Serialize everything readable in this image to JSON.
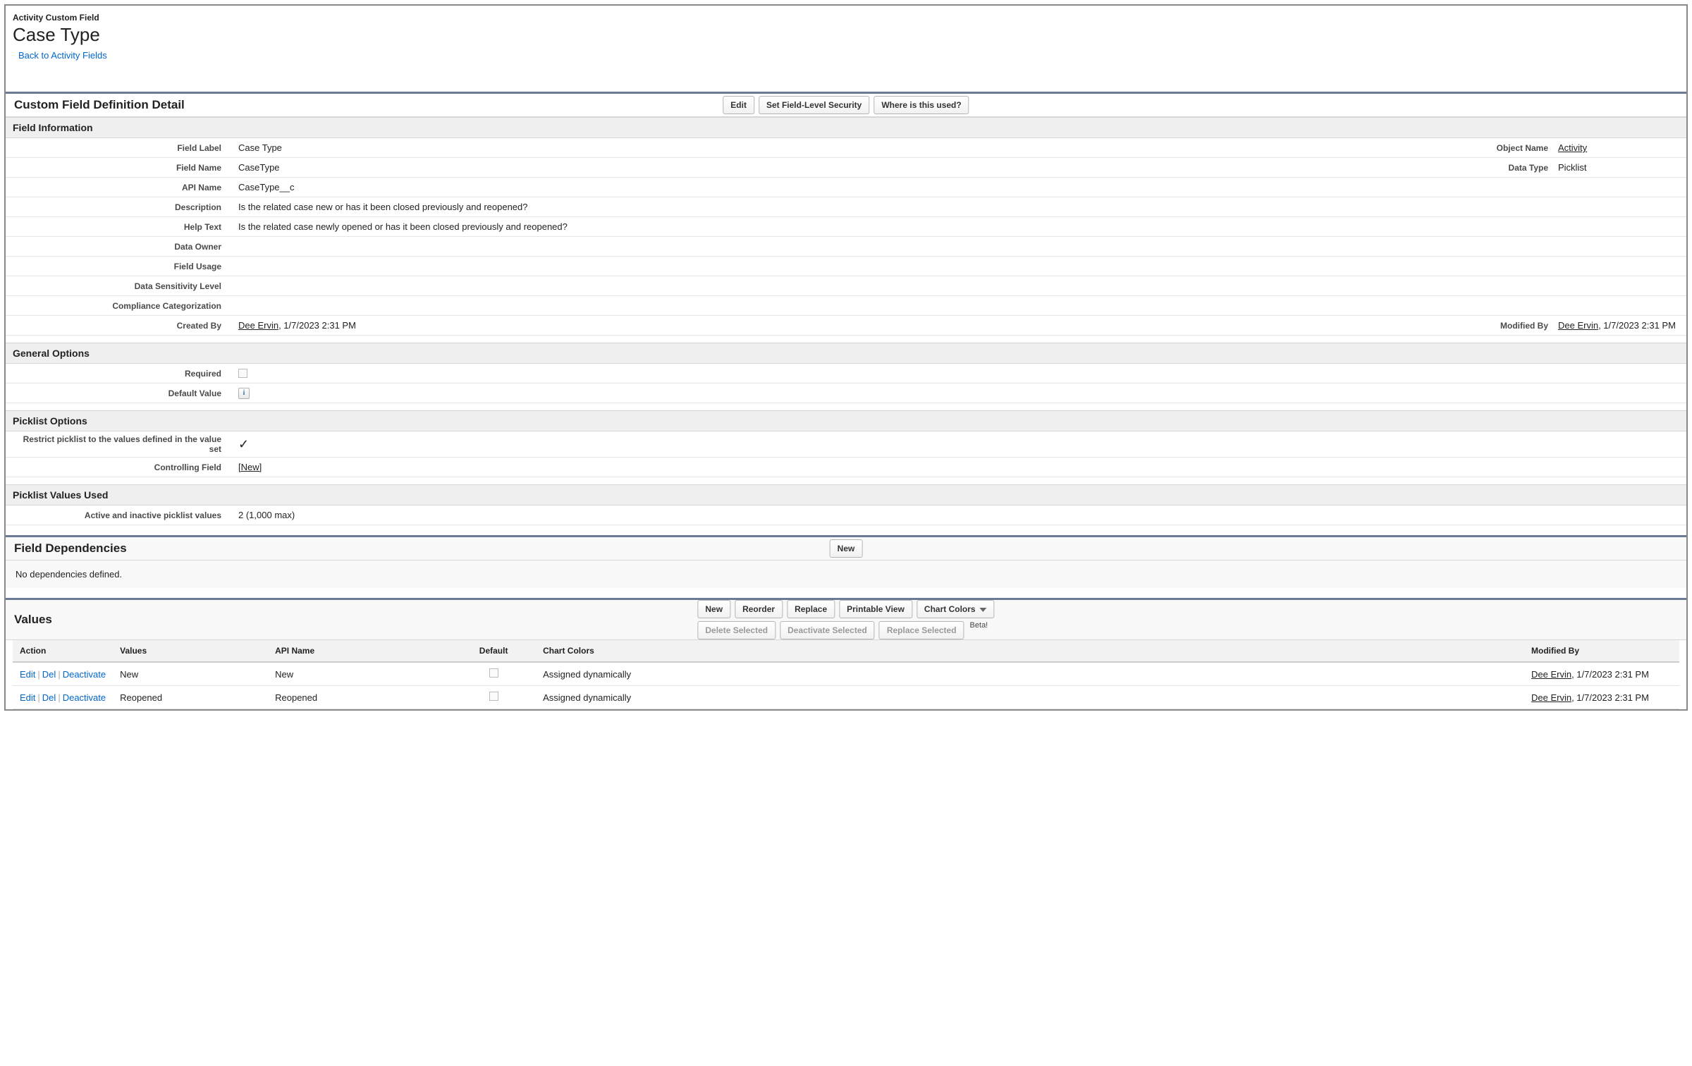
{
  "header": {
    "subtitle": "Activity Custom Field",
    "title": "Case Type",
    "back_link": "Back to Activity Fields"
  },
  "definition": {
    "section_title": "Custom Field Definition Detail",
    "buttons": {
      "edit": "Edit",
      "set_fls": "Set Field-Level Security",
      "where_used": "Where is this used?"
    }
  },
  "field_info": {
    "section_title": "Field Information",
    "labels": {
      "field_label": "Field Label",
      "field_name": "Field Name",
      "api_name": "API Name",
      "description": "Description",
      "help_text": "Help Text",
      "data_owner": "Data Owner",
      "field_usage": "Field Usage",
      "data_sensitivity": "Data Sensitivity Level",
      "compliance": "Compliance Categorization",
      "created_by": "Created By",
      "object_name": "Object Name",
      "data_type": "Data Type",
      "modified_by": "Modified By"
    },
    "values": {
      "field_label": "Case Type",
      "field_name": "CaseType",
      "api_name": "CaseType__c",
      "description": "Is the related case new or has it been closed previously and reopened?",
      "help_text": "Is the related case newly opened or has it been closed previously and reopened?",
      "created_by_user": "Dee Ervin",
      "created_by_date": ", 1/7/2023 2:31 PM",
      "object_name": "Activity",
      "data_type": "Picklist",
      "modified_by_user": "Dee Ervin",
      "modified_by_date": ", 1/7/2023 2:31 PM"
    }
  },
  "general_options": {
    "section_title": "General Options",
    "labels": {
      "required": "Required",
      "default_value": "Default Value"
    }
  },
  "picklist_options": {
    "section_title": "Picklist Options",
    "labels": {
      "restrict": "Restrict picklist to the values defined in the value set",
      "controlling": "Controlling Field"
    },
    "values": {
      "controlling": "[New]"
    }
  },
  "values_used": {
    "section_title": "Picklist Values Used",
    "labels": {
      "active_inactive": "Active and inactive picklist values"
    },
    "values": {
      "count": "2 (1,000 max)"
    }
  },
  "dependencies": {
    "section_title": "Field Dependencies",
    "buttons": {
      "new": "New"
    },
    "body": "No dependencies defined."
  },
  "values_section": {
    "section_title": "Values",
    "buttons": {
      "new": "New",
      "reorder": "Reorder",
      "replace": "Replace",
      "printable": "Printable View",
      "chart_colors": "Chart Colors",
      "delete_sel": "Delete Selected",
      "deactivate_sel": "Deactivate Selected",
      "replace_sel": "Replace Selected",
      "beta": "Beta!"
    },
    "columns": {
      "action": "Action",
      "values": "Values",
      "api_name": "API Name",
      "default": "Default",
      "chart_colors": "Chart Colors",
      "modified_by": "Modified By"
    },
    "row_actions": {
      "edit": "Edit",
      "del": "Del",
      "deactivate": "Deactivate"
    },
    "rows": [
      {
        "value": "New",
        "api_name": "New",
        "chart_colors": "Assigned dynamically",
        "modified_user": "Dee Ervin",
        "modified_date": ", 1/7/2023 2:31 PM"
      },
      {
        "value": "Reopened",
        "api_name": "Reopened",
        "chart_colors": "Assigned dynamically",
        "modified_user": "Dee Ervin",
        "modified_date": ", 1/7/2023 2:31 PM"
      }
    ]
  }
}
